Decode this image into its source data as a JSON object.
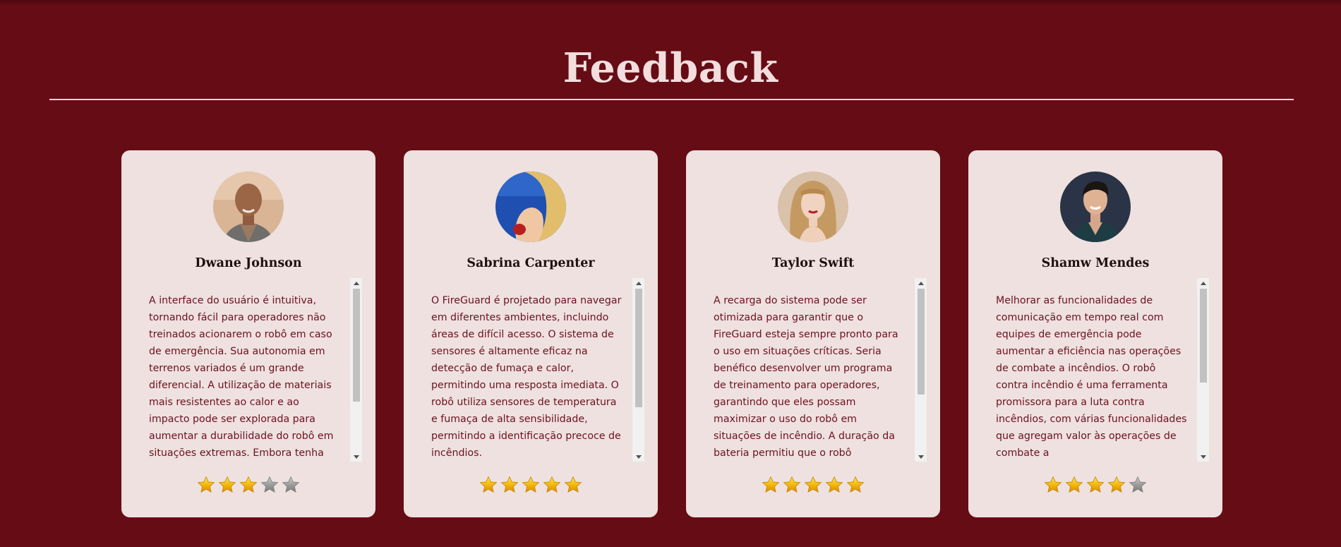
{
  "section": {
    "title": "Feedback"
  },
  "colors": {
    "background": "#660c15",
    "card": "#eee1df",
    "text": "#6e1020",
    "star_filled": "#f2b705",
    "star_empty": "#9a9a9a"
  },
  "cards": [
    {
      "name": "Dwane Johnson",
      "avatar_icon": "avatar-photo-icon",
      "text": "A interface do usuário é intuitiva, tornando fácil para operadores não treinados acionarem o robô em caso de emergência. Sua autonomia em terrenos variados é um grande diferencial. A utilização de materiais mais resistentes ao calor e ao impacto pode ser explorada para aumentar a durabilidade do robô em situações extremas. Embora tenha",
      "rating": 3,
      "rating_max": 5,
      "scroll_fraction": 0.0
    },
    {
      "name": "Sabrina Carpenter",
      "avatar_icon": "avatar-photo-icon",
      "text": "O FireGuard é projetado para navegar em diferentes ambientes, incluindo áreas de difícil acesso. O sistema de sensores é altamente eficaz na detecção de fumaça e calor, permitindo uma resposta imediata. O robô utiliza sensores de temperatura e fumaça de alta sensibilidade, permitindo a identificação precoce de incêndios.",
      "rating": 5,
      "rating_max": 5,
      "scroll_fraction": 0.0
    },
    {
      "name": "Taylor Swift",
      "avatar_icon": "avatar-photo-icon",
      "text": "A recarga do sistema pode ser otimizada para garantir que o FireGuard esteja sempre pronto para o uso em situações críticas. Seria benéfico desenvolver um programa de treinamento para operadores, garantindo que eles possam maximizar o uso do robô em situações de incêndio. A duração da bateria permitiu que o robô",
      "rating": 5,
      "rating_max": 5,
      "scroll_fraction": 0.0
    },
    {
      "name": "Shamw Mendes",
      "avatar_icon": "avatar-photo-icon",
      "text": "Melhorar as funcionalidades de comunicação em tempo real com equipes de emergência pode aumentar a eficiência nas operações de combate a incêndios. O robô contra incêndio é uma ferramenta promissora para a luta contra incêndios, com várias funcionalidades que agregam valor às operações de combate a",
      "rating": 4,
      "rating_max": 5,
      "scroll_fraction": 0.0
    }
  ]
}
